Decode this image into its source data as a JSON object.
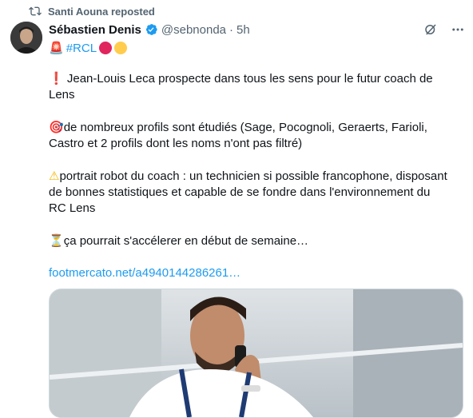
{
  "repost": {
    "text": "Santi Aouna reposted",
    "icon": "repost-icon"
  },
  "author": {
    "name": "Sébastien Denis",
    "handle": "@sebnonda",
    "separator": "·",
    "time": "5h",
    "verified_icon": "verified-badge-icon",
    "avatar_icon": "avatar"
  },
  "header_actions": {
    "grok_icon": "grok-icon",
    "more_icon": "more-icon"
  },
  "tagline": {
    "siren": "🚨",
    "hashtag": "#RCL",
    "circles": [
      "#e0245e",
      "#ffcc4d"
    ]
  },
  "tweet": {
    "p1_emoji": "❗",
    "p1_text": " Jean-Louis Leca prospecte dans tous les sens pour le futur coach de Lens",
    "p2_emoji": "🎯",
    "p2_text": "de nombreux profils sont étudiés (Sage, Pocognoli, Geraerts, Farioli, Castro et 2 profils dont les noms n'ont pas filtré)",
    "p3_emoji": "⚠",
    "p3_text": "portrait robot du coach : un technicien si possible francophone, disposant de bonnes statistiques et capable de se fondre dans l'environnement du RC Lens",
    "p4_emoji": "⏳",
    "p4_text": "ça pourrait s'accélerer en début de semaine…",
    "link": "footmercato.net/a4940144286261…"
  },
  "colors": {
    "accent": "#1d9bf0",
    "secondary_text": "#536471",
    "primary_text": "#0f1419"
  }
}
